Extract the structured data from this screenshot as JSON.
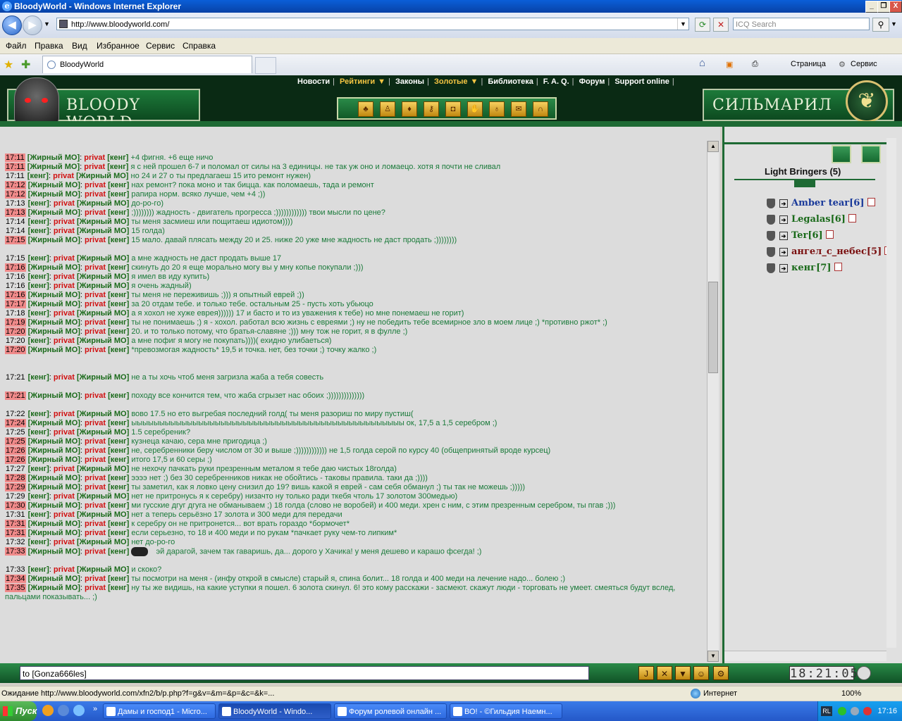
{
  "window": {
    "title": "BloodyWorld - Windows Internet Explorer",
    "minimize_glyph": "_",
    "maximize_glyph": "❐",
    "close_glyph": "X"
  },
  "address": {
    "url": "http://www.bloodyworld.com/",
    "search_placeholder": "ICQ Search"
  },
  "menu": [
    "Файл",
    "Правка",
    "Вид",
    "Избранное",
    "Сервис",
    "Справка"
  ],
  "tab": {
    "label": "BloodyWorld"
  },
  "commandbar": {
    "page_label": "Страница",
    "tools_label": "Сервис"
  },
  "site": {
    "nav": [
      "Новости",
      "Рейтинги",
      "Законы",
      "Золотые",
      "Библиотека",
      "F. A. Q.",
      "Форум",
      "Support online"
    ],
    "left_banner": "BLOODY WORLD",
    "right_banner": "СИЛЬМАРИЛ"
  },
  "group": {
    "title": "Light Bringers (5)",
    "members": [
      {
        "name": "Amber tear",
        "level": "[6]",
        "color": "#1a3a9a"
      },
      {
        "name": "Legalas",
        "level": "[6]",
        "color": "#1a6a1a"
      },
      {
        "name": "Ter",
        "level": "[6]",
        "color": "#1a6a1a"
      },
      {
        "name": "ангел_с_небес",
        "level": "[5]",
        "color": "#7a1010"
      },
      {
        "name": "кенг",
        "level": "[7]",
        "color": "#1a6a1a"
      }
    ]
  },
  "chat": [
    {
      "time": "17:11",
      "hl": true,
      "from": "[Жирный МО]",
      "to": "[кенг]",
      "msg": "+4 фигня. +6 еще ничо"
    },
    {
      "time": "17:11",
      "hl": true,
      "from": "[Жирный МО]",
      "to": "[кенг]",
      "msg": "я с ней прошел 6-7 и поломал от силы на 3 единицы. не так уж оно и ломаецо. хотя я почти не сливал"
    },
    {
      "time": "17:11",
      "hl": false,
      "from": "[кенг]",
      "to": "[Жирный МО]",
      "msg": "но 24 и 27 о ты предлагаеш 15 ито ремонт нужен)"
    },
    {
      "time": "17:12",
      "hl": true,
      "from": "[Жирный МО]",
      "to": "[кенг]",
      "msg": "нах ремонт? пока моно и так бицца. как поломаешь, тада и ремонт"
    },
    {
      "time": "17:12",
      "hl": true,
      "from": "[Жирный МО]",
      "to": "[кенг]",
      "msg": "рапира норм. всяко лучше, чем +4 ;))"
    },
    {
      "time": "17:13",
      "hl": false,
      "from": "[кенг]",
      "to": "[Жирный МО]",
      "msg": "до-ро-го)"
    },
    {
      "time": "17:13",
      "hl": true,
      "from": "[Жирный МО]",
      "to": "[кенг]",
      "msg": ";)))))))) жадность - двигатель прогресса ;)))))))))))) твои мысли по цене?"
    },
    {
      "time": "17:14",
      "hl": false,
      "from": "[кенг]",
      "to": "[Жирный МО]",
      "msg": "ты меня засмиеш или пощитаеш идиотом))))"
    },
    {
      "time": "17:14",
      "hl": false,
      "from": "[кенг]",
      "to": "[Жирный МО]",
      "msg": "15 голда)"
    },
    {
      "time": "17:15",
      "hl": true,
      "from": "[Жирный МО]",
      "to": "[кенг]",
      "msg": "15 мало. давай плясать между 20 и 25. ниже 20 уже мне жадность не даст продать ;))))))))"
    },
    {
      "gap": true
    },
    {
      "time": "17:15",
      "hl": false,
      "from": "[кенг]",
      "to": "[Жирный МО]",
      "msg": "а мне жадность не даст продать выше 17"
    },
    {
      "time": "17:16",
      "hl": true,
      "from": "[Жирный МО]",
      "to": "[кенг]",
      "msg": "скинуть до 20 я еще морально могу вы у мну копье покупали ;)))"
    },
    {
      "time": "17:16",
      "hl": false,
      "from": "[кенг]",
      "to": "[Жирный МО]",
      "msg": "я имел вв иду купить)"
    },
    {
      "time": "17:16",
      "hl": false,
      "from": "[кенг]",
      "to": "[Жирный МО]",
      "msg": "я очень жадный)"
    },
    {
      "time": "17:16",
      "hl": true,
      "from": "[Жирный МО]",
      "to": "[кенг]",
      "msg": "ты меня не переживишь ;))) я опытный еврей ;))"
    },
    {
      "time": "17:17",
      "hl": true,
      "from": "[Жирный МО]",
      "to": "[кенг]",
      "msg": "за 20 отдам тебе. и только тебе. остальным 25 - пусть хоть убьюцо"
    },
    {
      "time": "17:18",
      "hl": false,
      "from": "[кенг]",
      "to": "[Жирный МО]",
      "msg": "а я хохол не хуже еврея)))))) 17 и басто и то из уважения к тебе) но мне понемаеш не горит)"
    },
    {
      "time": "17:19",
      "hl": true,
      "from": "[Жирный МО]",
      "to": "[кенг]",
      "msg": "ты не понимаешь ;) я - хохол. работал всю жизнь с евреями ;) ну не победить тебе всемирное зло в моем лице ;) *противно ржот* ;)"
    },
    {
      "time": "17:20",
      "hl": true,
      "from": "[Жирный МО]",
      "to": "[кенг]",
      "msg": "20. и то только потому, что братья-славяне ;))) мну тож не горит, я в фулле ;)"
    },
    {
      "time": "17:20",
      "hl": false,
      "from": "[кенг]",
      "to": "[Жирный МО]",
      "msg": "а мне пофиг я могу не покупать))))( ехидно улибаеться)"
    },
    {
      "time": "17:20",
      "hl": true,
      "from": "[Жирный МО]",
      "to": "[кенг]",
      "msg": "*превозмогая жадность* 19,5 и точка. нет, без точки ;) точку жалко ;)"
    },
    {
      "gap": true
    },
    {
      "gap": true
    },
    {
      "time": "17:21",
      "hl": false,
      "from": "[кенг]",
      "to": "[Жирный МО]",
      "msg": "не а ты хочь чтоб меня загризла жаба а тебя совесть"
    },
    {
      "gap": true
    },
    {
      "time": "17:21",
      "hl": true,
      "from": "[Жирный МО]",
      "to": "[кенг]",
      "msg": "походу все кончится тем, что жаба сгрызет нас обоих ;))))))))))))))"
    },
    {
      "gap": true
    },
    {
      "time": "17:22",
      "hl": false,
      "from": "[кенг]",
      "to": "[Жирный МО]",
      "msg": "вово 17.5 но ето выгребая последний голд( ты меня разориш по миру пустиш("
    },
    {
      "time": "17:24",
      "hl": true,
      "from": "[Жирный МО]",
      "to": "[кенг]",
      "msg": "ыыыыыыыыыыыыыыыыыыыыыыыыыыыыыыыыыыыыыыыыыыыыыыыыы ок, 17,5 а 1,5 серебром ;)"
    },
    {
      "time": "17:25",
      "hl": false,
      "from": "[кенг]",
      "to": "[Жирный МО]",
      "msg": "1.5 серебреник?"
    },
    {
      "time": "17:25",
      "hl": true,
      "from": "[Жирный МО]",
      "to": "[кенг]",
      "msg": "кузнеца качаю, сера мне пригодица ;)"
    },
    {
      "time": "17:26",
      "hl": true,
      "from": "[Жирный МО]",
      "to": "[кенг]",
      "msg": "не, серебренники беру числом от 30 и выше ;)))))))))))) не 1,5 голда серой по курсу 40 (общепринятый вроде курсец)"
    },
    {
      "time": "17:26",
      "hl": true,
      "from": "[Жирный МО]",
      "to": "[кенг]",
      "msg": "итого 17,5 и 60 серы ;)"
    },
    {
      "time": "17:27",
      "hl": false,
      "from": "[кенг]",
      "to": "[Жирный МО]",
      "msg": "не нехочу пачкать руки презренным металом я тебе даю чистых 18голда)"
    },
    {
      "time": "17:28",
      "hl": true,
      "from": "[Жирный МО]",
      "to": "[кенг]",
      "msg": "ээээ нет ;) без 30 серебренников никак не обойтись - таковы правила. таки да ;))))"
    },
    {
      "time": "17:29",
      "hl": true,
      "from": "[Жирный МО]",
      "to": "[кенг]",
      "msg": "ты заметил, как я ловко цену снизил до 19? вишь какой я еврей - сам себя обманул ;) ты так не можешь ;)))))"
    },
    {
      "time": "17:29",
      "hl": false,
      "from": "[кенг]",
      "to": "[Жирный МО]",
      "msg": "нет не притронусь я к серебру) низачто ну только ради ткебя чтоль 17 золотом 300медью)"
    },
    {
      "time": "17:30",
      "hl": true,
      "from": "[Жирный МО]",
      "to": "[кенг]",
      "msg": "ми гусские дгуг дгуга не обманываем ;) 18 голда (слово не воробей) и 400 меди. хрен с ним, с этим презренным серебром, ты пгав ;)))"
    },
    {
      "time": "17:31",
      "hl": false,
      "from": "[кенг]",
      "to": "[Жирный МО]",
      "msg": "нет а теперь серьёзно 17 золота и 300 меди для передачи"
    },
    {
      "time": "17:31",
      "hl": true,
      "from": "[Жирный МО]",
      "to": "[кенг]",
      "msg": "к серебру он не притронется... вот врать гораздо *бормочет*"
    },
    {
      "time": "17:31",
      "hl": true,
      "from": "[Жирный МО]",
      "to": "[кенг]",
      "msg": "если серьезно, то 18 и 400 меди и по рукам *пачкает руку чем-то липким*"
    },
    {
      "time": "17:32",
      "hl": false,
      "from": "[кенг]",
      "to": "[Жирный МО]",
      "msg": "нет до-ро-го"
    },
    {
      "time": "17:33",
      "hl": true,
      "from": "[Жирный МО]",
      "to": "[кенг]",
      "msg": "   эй дарагой, зачем так гаваришь, да... дорого у Хачика! у меня дешево и карашо фсегда! ;)",
      "smiley": true
    },
    {
      "gap": true
    },
    {
      "time": "17:33",
      "hl": false,
      "from": "[кенг]",
      "to": "[Жирный МО]",
      "msg": "и скоко?"
    },
    {
      "time": "17:34",
      "hl": true,
      "from": "[Жирный МО]",
      "to": "[кенг]",
      "msg": "ты посмотри на меня - (инфу открой в смысле) старый я, спина болит... 18 голда и 400 меди на лечение надо... болею ;)"
    },
    {
      "time": "17:35",
      "hl": true,
      "from": "[Жирный МО]",
      "to": "[кенг]",
      "msg": "ну ты же видишь, на какие уступки я пошел. 6 золота скинул. 6! это кому расскажи - засмеют. скажут люди - торговать не умеет. смеяться будут вслед, пальцами показывать... ;)"
    }
  ],
  "privat_word": "privat",
  "input": {
    "value": "to [Gonza666les]"
  },
  "clock": "18:21:05",
  "status": {
    "text": "Ожидание http://www.bloodyworld.com/xfn2/b/p.php?f=g&v=&m=&p=&c=&k=...",
    "zone": "Интернет",
    "zoom": "100%"
  },
  "taskbar": {
    "start": "Пуск",
    "items": [
      "Дамы и господ1 - Micro...",
      "BloodyWorld - Windo...",
      "Форум ролевой онлайн ...",
      "ВО! - ©Гильдия Наемн..."
    ],
    "time": "17:16",
    "lang": "RL"
  }
}
